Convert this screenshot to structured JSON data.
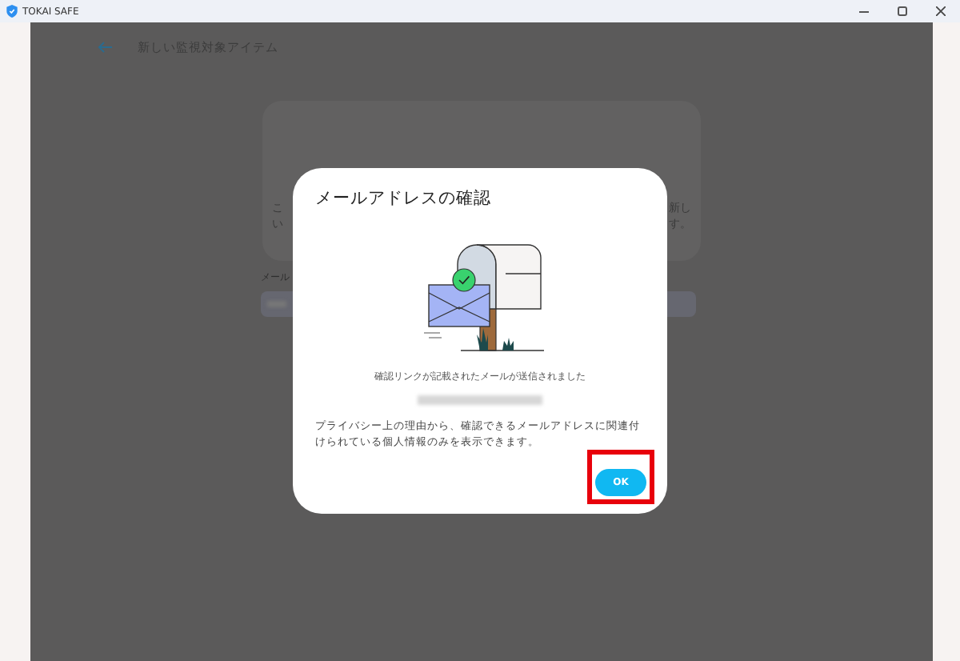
{
  "window": {
    "title": "TOKAI SAFE"
  },
  "page": {
    "title": "新しい監視対象アイテム",
    "card_left_fragments": [
      "こ",
      "い"
    ],
    "card_right_fragments": [
      "新し",
      "す。"
    ],
    "field_label": "メール"
  },
  "dialog": {
    "title": "メールアドレスの確認",
    "message": "確認リンクが記載されたメールが送信されました",
    "note": "プライバシー上の理由から、確認できるメールアドレスに関連付けられている個人情報のみを表示できます。",
    "buttons": [
      {
        "label": "OK",
        "highlighted": true
      }
    ]
  }
}
